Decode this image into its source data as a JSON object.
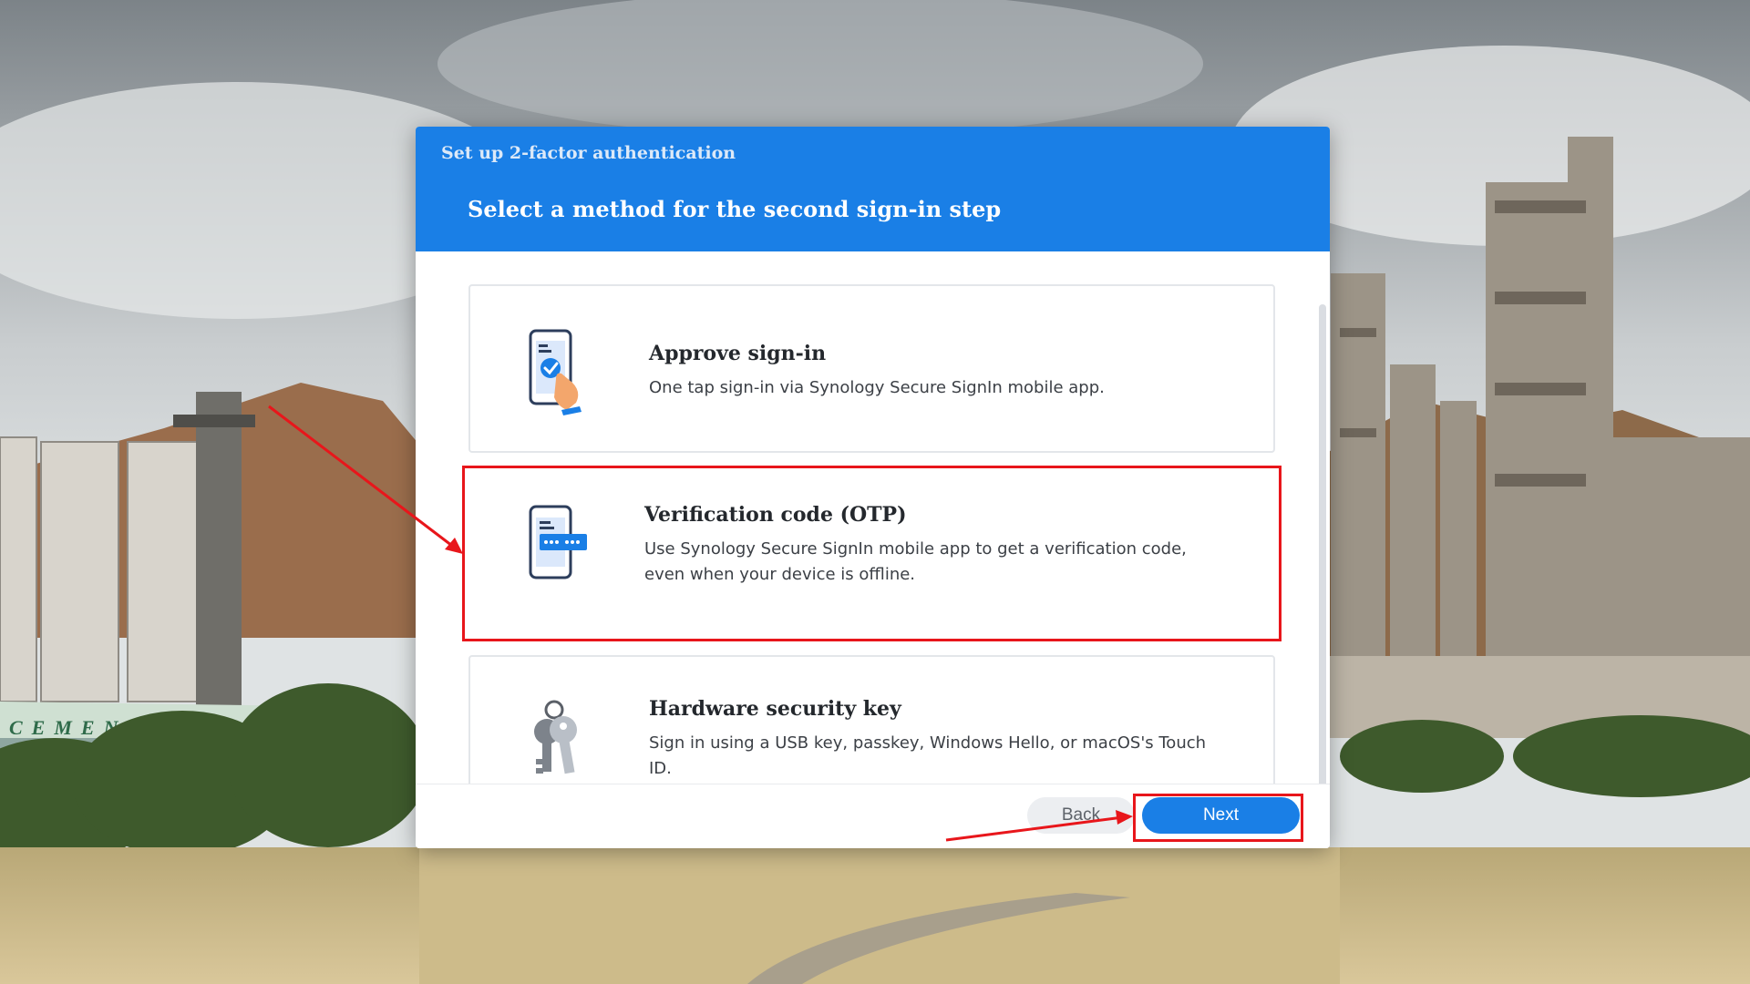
{
  "dialog": {
    "caption": "Set up 2-factor authentication",
    "title": "Select a method for the second sign-in step",
    "options": [
      {
        "title": "Approve sign-in",
        "description": "One tap sign-in via Synology Secure SignIn mobile app.",
        "icon": "phone-tap-approve-icon"
      },
      {
        "title": "Verification code (OTP)",
        "description": "Use Synology Secure SignIn mobile app to get a verification code, even when your device is offline.",
        "icon": "phone-otp-code-icon"
      },
      {
        "title": "Hardware security key",
        "description": "Sign in using a USB key, passkey, Windows Hello, or macOS's Touch ID.",
        "icon": "keys-icon"
      }
    ],
    "footer": {
      "back_label": "Back",
      "next_label": "Next"
    }
  },
  "background": {
    "sign_text": "CEMENT"
  },
  "colors": {
    "accent": "#1a7fe6",
    "annotation": "#e8161b"
  }
}
